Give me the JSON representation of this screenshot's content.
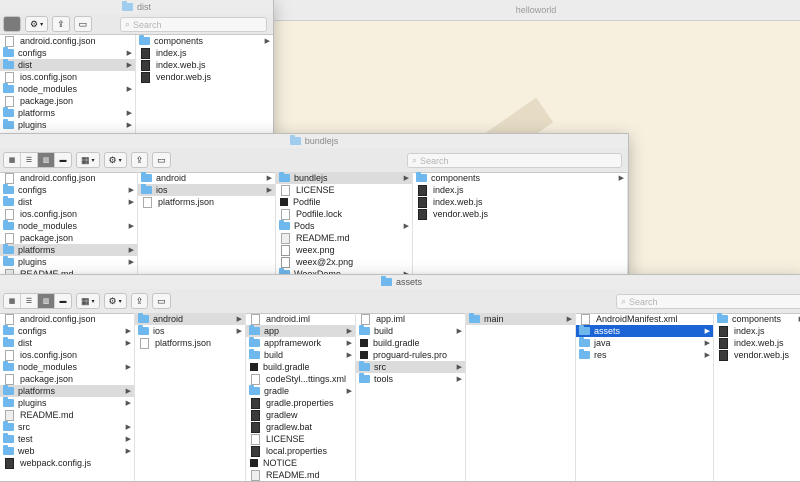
{
  "background_window": {
    "title": "helloworld"
  },
  "dist_window": {
    "title": "dist",
    "search_placeholder": "Search",
    "col1": [
      {
        "icon": "file-icon",
        "label": "android.config.json",
        "chevron": false
      },
      {
        "icon": "folder-icon",
        "label": "configs",
        "chevron": true
      },
      {
        "icon": "folder-icon",
        "label": "dist",
        "chevron": true,
        "selected": true
      },
      {
        "icon": "file-icon",
        "label": "ios.config.json",
        "chevron": false
      },
      {
        "icon": "folder-icon",
        "label": "node_modules",
        "chevron": true
      },
      {
        "icon": "file-icon",
        "label": "package.json",
        "chevron": false
      },
      {
        "icon": "folder-icon",
        "label": "platforms",
        "chevron": true
      },
      {
        "icon": "folder-icon",
        "label": "plugins",
        "chevron": true
      }
    ],
    "col2": [
      {
        "icon": "folder-icon",
        "label": "components",
        "chevron": true
      },
      {
        "icon": "js-file-icon",
        "label": "index.js",
        "chevron": false
      },
      {
        "icon": "js-file-icon",
        "label": "index.web.js",
        "chevron": false
      },
      {
        "icon": "js-file-icon",
        "label": "vendor.web.js",
        "chevron": false
      }
    ]
  },
  "bundlejs_window": {
    "title": "bundlejs",
    "search_placeholder": "Search",
    "col1": [
      {
        "icon": "file-icon",
        "label": "android.config.json",
        "chevron": false
      },
      {
        "icon": "folder-icon",
        "label": "configs",
        "chevron": true
      },
      {
        "icon": "folder-icon",
        "label": "dist",
        "chevron": true
      },
      {
        "icon": "file-icon",
        "label": "ios.config.json",
        "chevron": false
      },
      {
        "icon": "folder-icon",
        "label": "node_modules",
        "chevron": true
      },
      {
        "icon": "file-icon",
        "label": "package.json",
        "chevron": false
      },
      {
        "icon": "folder-icon",
        "label": "platforms",
        "chevron": true,
        "selected": true
      },
      {
        "icon": "folder-icon",
        "label": "plugins",
        "chevron": true
      },
      {
        "icon": "markdown-file-icon",
        "label": "README.md",
        "chevron": false
      }
    ],
    "col2": [
      {
        "icon": "folder-icon",
        "label": "android",
        "chevron": true
      },
      {
        "icon": "folder-icon",
        "label": "ios",
        "chevron": true,
        "selected": true
      },
      {
        "icon": "file-icon",
        "label": "platforms.json",
        "chevron": false
      }
    ],
    "col3": [
      {
        "icon": "folder-icon",
        "label": "bundlejs",
        "chevron": true,
        "selected": true
      },
      {
        "icon": "file-icon",
        "label": "LICENSE",
        "chevron": false
      },
      {
        "icon": "dark-file-icon",
        "label": "Podfile",
        "chevron": false
      },
      {
        "icon": "file-icon",
        "label": "Podfile.lock",
        "chevron": false
      },
      {
        "icon": "folder-icon",
        "label": "Pods",
        "chevron": true
      },
      {
        "icon": "markdown-file-icon",
        "label": "README.md",
        "chevron": false
      },
      {
        "icon": "image-file-icon",
        "label": "weex.png",
        "chevron": false
      },
      {
        "icon": "image-file-icon",
        "label": "weex@2x.png",
        "chevron": false
      },
      {
        "icon": "folder-icon",
        "label": "WeexDemo",
        "chevron": true
      }
    ],
    "col4": [
      {
        "icon": "folder-icon",
        "label": "components",
        "chevron": true
      },
      {
        "icon": "js-file-icon",
        "label": "index.js",
        "chevron": false
      },
      {
        "icon": "js-file-icon",
        "label": "index.web.js",
        "chevron": false
      },
      {
        "icon": "js-file-icon",
        "label": "vendor.web.js",
        "chevron": false
      }
    ]
  },
  "assets_window": {
    "title": "assets",
    "search_placeholder": "Search",
    "col1": [
      {
        "icon": "file-icon",
        "label": "android.config.json",
        "chevron": false
      },
      {
        "icon": "folder-icon",
        "label": "configs",
        "chevron": true
      },
      {
        "icon": "folder-icon",
        "label": "dist",
        "chevron": true
      },
      {
        "icon": "file-icon",
        "label": "ios.config.json",
        "chevron": false
      },
      {
        "icon": "folder-icon",
        "label": "node_modules",
        "chevron": true
      },
      {
        "icon": "file-icon",
        "label": "package.json",
        "chevron": false
      },
      {
        "icon": "folder-icon",
        "label": "platforms",
        "chevron": true,
        "selected": true
      },
      {
        "icon": "folder-icon",
        "label": "plugins",
        "chevron": true
      },
      {
        "icon": "markdown-file-icon",
        "label": "README.md",
        "chevron": false
      },
      {
        "icon": "folder-icon",
        "label": "src",
        "chevron": true
      },
      {
        "icon": "folder-icon",
        "label": "test",
        "chevron": true
      },
      {
        "icon": "folder-icon",
        "label": "web",
        "chevron": true
      },
      {
        "icon": "js-file-icon",
        "label": "webpack.config.js",
        "chevron": false
      }
    ],
    "col2": [
      {
        "icon": "folder-icon",
        "label": "android",
        "chevron": true,
        "selected": true
      },
      {
        "icon": "folder-icon",
        "label": "ios",
        "chevron": true
      },
      {
        "icon": "file-icon",
        "label": "platforms.json",
        "chevron": false
      }
    ],
    "col3": [
      {
        "icon": "file-icon",
        "label": "android.iml",
        "chevron": false
      },
      {
        "icon": "folder-icon",
        "label": "app",
        "chevron": true,
        "selected": true
      },
      {
        "icon": "folder-icon",
        "label": "appframework",
        "chevron": true
      },
      {
        "icon": "folder-icon",
        "label": "build",
        "chevron": true
      },
      {
        "icon": "dark-file-icon",
        "label": "build.gradle",
        "chevron": false
      },
      {
        "icon": "file-icon",
        "label": "codeStyl...ttings.xml",
        "chevron": false
      },
      {
        "icon": "folder-icon",
        "label": "gradle",
        "chevron": true
      },
      {
        "icon": "js-file-icon",
        "label": "gradle.properties",
        "chevron": false
      },
      {
        "icon": "js-file-icon",
        "label": "gradlew",
        "chevron": false
      },
      {
        "icon": "js-file-icon",
        "label": "gradlew.bat",
        "chevron": false
      },
      {
        "icon": "file-icon",
        "label": "LICENSE",
        "chevron": false
      },
      {
        "icon": "js-file-icon",
        "label": "local.properties",
        "chevron": false
      },
      {
        "icon": "dark-file-icon",
        "label": "NOTICE",
        "chevron": false
      },
      {
        "icon": "markdown-file-icon",
        "label": "README.md",
        "chevron": false
      }
    ],
    "col4": [
      {
        "icon": "file-icon",
        "label": "app.iml",
        "chevron": false
      },
      {
        "icon": "folder-icon",
        "label": "build",
        "chevron": true
      },
      {
        "icon": "dark-file-icon",
        "label": "build.gradle",
        "chevron": false
      },
      {
        "icon": "dark-file-icon",
        "label": "proguard-rules.pro",
        "chevron": false
      },
      {
        "icon": "folder-icon",
        "label": "src",
        "chevron": true,
        "selected": true
      },
      {
        "icon": "folder-icon",
        "label": "tools",
        "chevron": true
      }
    ],
    "col5": [
      {
        "icon": "folder-icon",
        "label": "main",
        "chevron": true,
        "selected": true
      }
    ],
    "col6": [
      {
        "icon": "file-icon",
        "label": "AndroidManifest.xml",
        "chevron": false
      },
      {
        "icon": "folder-icon",
        "label": "assets",
        "chevron": true,
        "selected_blue": true
      },
      {
        "icon": "folder-icon",
        "label": "java",
        "chevron": true
      },
      {
        "icon": "folder-icon",
        "label": "res",
        "chevron": true
      }
    ],
    "col7": [
      {
        "icon": "folder-icon",
        "label": "components",
        "chevron": true
      },
      {
        "icon": "js-file-icon",
        "label": "index.js",
        "chevron": false
      },
      {
        "icon": "js-file-icon",
        "label": "index.web.js",
        "chevron": false
      },
      {
        "icon": "js-file-icon",
        "label": "vendor.web.js",
        "chevron": false
      }
    ]
  },
  "colors": {
    "folder": "#6fb8ee",
    "selection_blue": "#1a64d6",
    "selection_gray": "#dcdcdc"
  }
}
